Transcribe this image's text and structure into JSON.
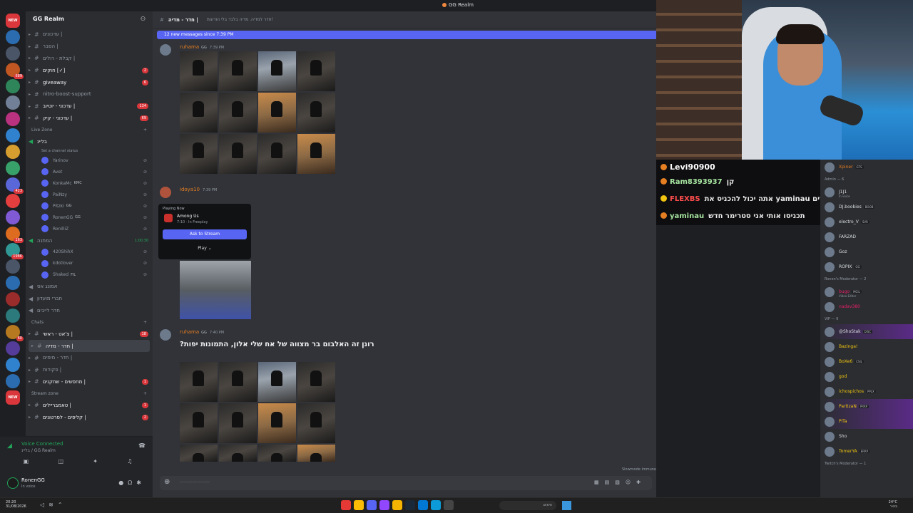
{
  "window": {
    "title": "GG Realm"
  },
  "server_list": {
    "top_badge": "NEW",
    "bottom_badge": "NEW",
    "badges": [
      "",
      "",
      "689",
      "",
      "",
      "",
      "",
      "",
      "",
      "423",
      "",
      "",
      "163",
      "1986",
      "",
      "",
      "",
      "",
      "60",
      "",
      "",
      ""
    ]
  },
  "sidebar": {
    "server_name": "GG Realm",
    "channels_top": [
      {
        "label": "עדכונים |",
        "count": ""
      },
      {
        "label": "הסבר |",
        "count": ""
      },
      {
        "label": "קבלת - רולים |",
        "count": ""
      },
      {
        "label": "חוקים [✓]",
        "count": "2"
      },
      {
        "label": "giveaway",
        "count": "6"
      },
      {
        "label": "nitro-boost-support",
        "count": ""
      },
      {
        "label": "עדכוני - יוטיוב |",
        "count": "134"
      },
      {
        "label": "עדכוני - קיק |",
        "count": "69"
      }
    ],
    "live_zone_label": "Live Zone",
    "voice_channel": "בליינ",
    "voice_status": "Set a channel status",
    "voice_users": [
      {
        "name": "Yarinov",
        "tag": ""
      },
      {
        "name": "Avet",
        "tag": ""
      },
      {
        "name": "KonkaMc",
        "tag": "KMC"
      },
      {
        "name": "PaiNzy",
        "tag": ""
      },
      {
        "name": "Pitzki",
        "tag": "GG"
      },
      {
        "name": "RonenGG",
        "tag": "GG"
      },
      {
        "name": "RonilliZ",
        "tag": ""
      }
    ],
    "voice_channel_2": "המתנה",
    "voice_channel_2_time": "1:00:30",
    "voice_users_2": [
      {
        "name": "420ShihX",
        "tag": ""
      },
      {
        "name": "kdotlover",
        "tag": ""
      },
      {
        "name": "Shaked",
        "tag": "FIL"
      }
    ],
    "channels_mid": [
      {
        "label": "אמונג אס",
        "count": ""
      },
      {
        "label": "חברי מועדון",
        "count": ""
      },
      {
        "label": "חדר לייבים",
        "count": ""
      }
    ],
    "chats_label": "Chats",
    "channels_chats": [
      {
        "label": "צ'אט - ראשי |",
        "count": "18"
      },
      {
        "label": "חדר - מדיה |",
        "count": "",
        "active": true
      },
      {
        "label": "חדר - מימים |",
        "count": ""
      },
      {
        "label": "פקודות |",
        "count": ""
      },
      {
        "label": "מחפשים - שחקנים |",
        "count": "1"
      }
    ],
    "stream_zone_label": "Stream zone",
    "channels_stream": [
      {
        "label": "טאמבריילים |",
        "count": "1"
      },
      {
        "label": "קליפים - לסרטונים |",
        "count": "2"
      }
    ]
  },
  "voice_panel": {
    "status": "Voice Connected",
    "location": "בליינ / GG Realm"
  },
  "user_panel": {
    "username": "RonenGG",
    "status": "In voice"
  },
  "channel": {
    "name": "חדר - מדיה |",
    "topic": "חדר למדיה. מדיה בלבד בלי הודעות!",
    "new_messages": "12 new messages since 7:39 PM"
  },
  "messages": [
    {
      "author": "ruhama",
      "tag": "GG",
      "time": "7:39 PM"
    },
    {
      "author": "idoya10",
      "tag": "",
      "time": "7:39 PM"
    },
    {
      "author": "ruhama",
      "tag": "GG",
      "time": "7:40 PM",
      "text": "רונן זה האלבום בר מצווה של אח שלי אלון, התמונות יפות?"
    }
  ],
  "popup": {
    "header": "Playing Now",
    "game": "Among Us",
    "sub": "7:10 · In Freeplay",
    "ask_button": "Ask to Stream",
    "play_button": "Play"
  },
  "composer": {
    "placeholder": "———————",
    "slowmode": "Slowmode immune"
  },
  "twitch_chat": [
    {
      "user": "Levi90900",
      "text": "",
      "color": "#ffffff"
    },
    {
      "user": "Ram8393937",
      "text": "קן",
      "color": "#a8e6a1"
    },
    {
      "user": "FLEXBS",
      "text": "אתה יכול להכניס את yaminau לשדרים",
      "color": "#ff4d4d"
    },
    {
      "user": "yaminau",
      "text": "תכניסו אותי אני סטרימר חדש",
      "color": "#a8e6a1"
    }
  ],
  "members": {
    "top": [
      {
        "name": "Xpiner",
        "badge": "GTS",
        "sub": "",
        "color": "#e67e22"
      }
    ],
    "admin_header": "Admin — 6",
    "admins": [
      {
        "name": "J1J1",
        "badge": "",
        "sub": "In voice",
        "color": "#dbdee1"
      },
      {
        "name": "DJ.boobies",
        "badge": "BOOB",
        "sub": "",
        "color": "#dbdee1"
      },
      {
        "name": "electro_V",
        "badge": "SVR",
        "sub": "",
        "color": "#dbdee1"
      },
      {
        "name": "FARZAD",
        "badge": "",
        "sub": "",
        "color": "#dbdee1"
      },
      {
        "name": "Goz",
        "badge": "",
        "sub": "",
        "color": "#dbdee1"
      },
      {
        "name": "ROPIX",
        "badge": "GG",
        "sub": "",
        "color": "#dbdee1"
      }
    ],
    "mod_header": "Ronen's Moderator — 2",
    "mods": [
      {
        "name": "bugo",
        "badge": "MCIL",
        "sub": "Video Editor",
        "color": "#e91e63"
      },
      {
        "name": "nadav380",
        "badge": "",
        "sub": "",
        "color": "#e91e63"
      }
    ],
    "vip_header": "VIP — 9",
    "vips": [
      {
        "name": "@ShoStak",
        "badge": "DISC",
        "sub": "",
        "color": "#dbdee1",
        "hl": true
      },
      {
        "name": "Bazinga!",
        "badge": "",
        "sub": "",
        "color": "#f1c40f"
      },
      {
        "name": "BoXe6",
        "badge": "CSIL",
        "sub": "",
        "color": "#f1c40f"
      },
      {
        "name": "god",
        "badge": "",
        "sub": "",
        "color": "#f1c40f"
      },
      {
        "name": "ichospichos",
        "badge": "PPLX",
        "sub": "",
        "color": "#f1c40f"
      },
      {
        "name": "PartizaN",
        "badge": "PRRP",
        "sub": "",
        "color": "#f1c40f",
        "hl": true
      },
      {
        "name": "PiTa",
        "badge": "",
        "sub": "",
        "color": "#f1c40f",
        "hl": true
      },
      {
        "name": "Sho",
        "badge": "",
        "sub": "",
        "color": "#dbdee1"
      },
      {
        "name": "TomerYA",
        "badge": "ERRP",
        "sub": "",
        "color": "#f1c40f"
      }
    ],
    "twitch_mod_header": "Twitch's Moderator — 1"
  },
  "taskbar": {
    "time": "20:20",
    "date": "31/08/2026",
    "search": "חיפוש",
    "temp": "24°C",
    "weather": "בהיר"
  }
}
